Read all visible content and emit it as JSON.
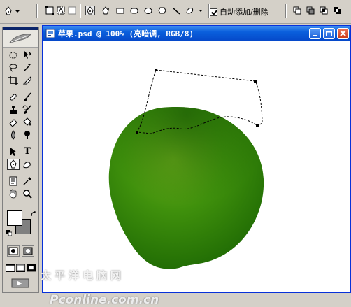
{
  "options_bar": {
    "auto_add_delete_label": "自动添加/删除",
    "auto_add_delete_checked": true
  },
  "document": {
    "title": "苹果.psd @ 100% (亮暗调, RGB/8)"
  },
  "tools": {
    "type_tool_glyph": "T"
  },
  "watermark": {
    "text": "Pconline.com.cn",
    "subtext": "太平洋电脑网"
  },
  "colors": {
    "apple_highlight": "#6aac1a",
    "apple_mid": "#3f900c",
    "apple_dark": "#1f6a04",
    "titlebar_blue": "#0a5fdc",
    "ui_gray": "#d4d0c8"
  }
}
